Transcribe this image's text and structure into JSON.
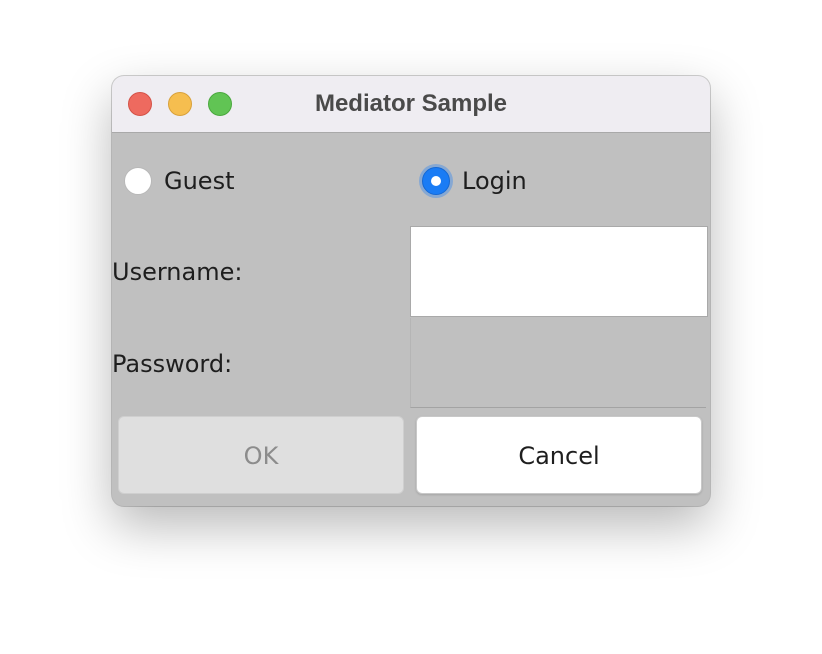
{
  "window": {
    "title": "Mediator Sample"
  },
  "mode": {
    "guest_label": "Guest",
    "login_label": "Login",
    "selected": "Login"
  },
  "form": {
    "username_label": "Username:",
    "username_value": "",
    "password_label": "Password:",
    "password_value": ""
  },
  "buttons": {
    "ok_label": "OK",
    "ok_enabled": false,
    "cancel_label": "Cancel",
    "cancel_enabled": true
  },
  "colors": {
    "window_background": "#c0c0c0",
    "titlebar_background": "#efedf2",
    "selected_radio": "#1a7cf5",
    "close_light": "#ee6a5f",
    "minimize_light": "#f6be4f",
    "maximize_light": "#61c454"
  },
  "icons": {
    "close": "close-traffic-light-icon",
    "minimize": "minimize-traffic-light-icon",
    "maximize": "maximize-traffic-light-icon"
  }
}
